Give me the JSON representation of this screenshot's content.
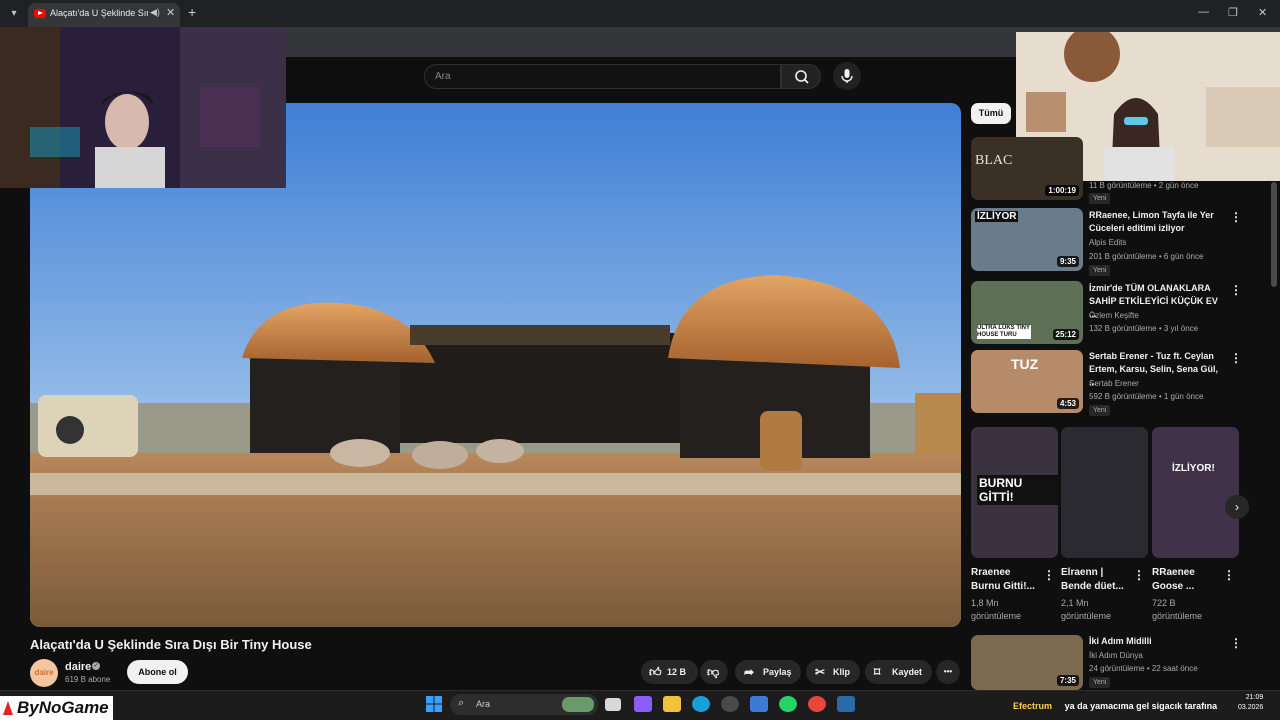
{
  "browser": {
    "tab_title": "Alaçatı'da U Şeklinde Sıra D",
    "tab_close": "✕",
    "new_tab": "+",
    "window_controls": [
      "—",
      "❐",
      "✕"
    ]
  },
  "header": {
    "search_placeholder": "Ara"
  },
  "video": {
    "title": "Alaçatı'da U Şeklinde Sıra Dışı Bir Tiny House",
    "channel_name": "daire",
    "channel_avatar_text": "daire",
    "subscribers": "619 B abone",
    "subscribe_label": "Abone ol",
    "likes": "12 B",
    "share_label": "Paylaş",
    "clip_label": "Klip",
    "save_label": "Kaydet",
    "more_label": "•••"
  },
  "sidebar": {
    "chip_all": "Tümü",
    "recommendations": [
      {
        "thumb_text": "BLAC",
        "duration": "1:00:19",
        "title": "",
        "channel": "",
        "meta": "11 B görüntüleme • 2 gün önce",
        "badge": "Yeni"
      },
      {
        "thumb_text": "İZLİYOR",
        "duration": "9:35",
        "title": "RRaenee, Limon Tayfa ile Yer Cüceleri editimi izliyor",
        "channel": "Alpis Edits",
        "meta": "201 B görüntüleme • 6 gün önce",
        "badge": "Yeni"
      },
      {
        "thumb_text": "ULTRA LÜKS TINY HOUSE TURU",
        "duration": "25:12",
        "title": "İzmir'de TÜM OLANAKLARA SAHİP ETKİLEYİCİ KÜÇÜK EV ...",
        "channel": "Özlem Keşifte",
        "meta": "132 B görüntüleme • 3 yıl önce",
        "badge": ""
      },
      {
        "thumb_text": "TUZ",
        "duration": "4:53",
        "title": "Sertab Erener - Tuz ft. Ceylan Ertem, Karsu, Selin, Sena Gül, ...",
        "channel": "Sertab Erener",
        "meta": "592 B görüntüleme • 1 gün önce",
        "badge": "Yeni"
      },
      {
        "thumb_text": "",
        "duration": "7:35",
        "title": "İki Adım Midilli",
        "channel": "İki Adım Dünya",
        "meta": "24 görüntüleme • 22 saat önce",
        "badge": "Yeni"
      }
    ],
    "shorts": [
      {
        "thumb_text": "BURNU GİTTİ!",
        "title_line1": "Rraenee",
        "title_line2": "Burnu Gitti!...",
        "views_line1": "1,8 Mn",
        "views_line2": "görüntüleme"
      },
      {
        "thumb_text": "",
        "title_line1": "Elraenn |",
        "title_line2": "Bende düet...",
        "views_line1": "2,1 Mn",
        "views_line2": "görüntüleme"
      },
      {
        "thumb_text": "İZLİYOR!",
        "title_line1": "RRaenee",
        "title_line2": "Goose ...",
        "views_line1": "722 B",
        "views_line2": "görüntüleme"
      }
    ]
  },
  "overlay": {
    "brand": "ByNoGame",
    "ticker_name": "Efectrum",
    "ticker_text": "ya da yamacıma gel sigacık tarafına"
  },
  "taskbar": {
    "search_label": "Ara",
    "time": "21:09",
    "date": "03.2026"
  }
}
